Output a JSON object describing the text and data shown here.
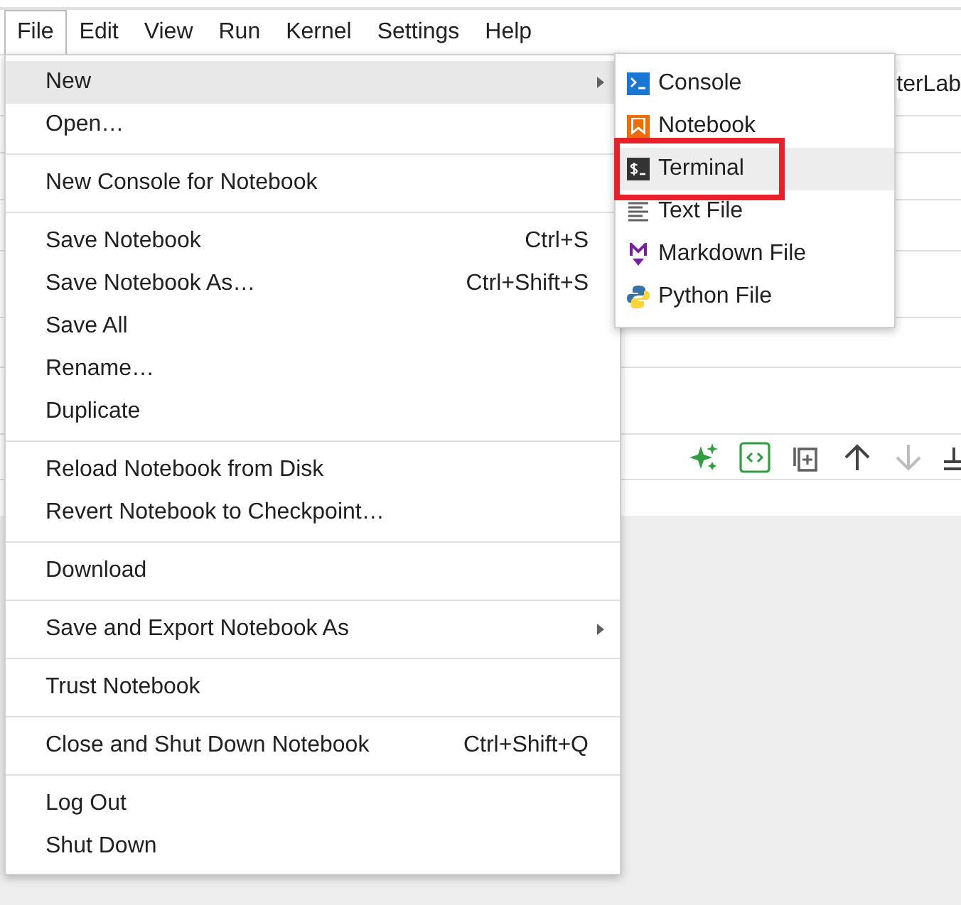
{
  "menubar": [
    {
      "label": "File",
      "selected": true
    },
    {
      "label": "Edit",
      "selected": false
    },
    {
      "label": "View",
      "selected": false
    },
    {
      "label": "Run",
      "selected": false
    },
    {
      "label": "Kernel",
      "selected": false
    },
    {
      "label": "Settings",
      "selected": false
    },
    {
      "label": "Help",
      "selected": false
    }
  ],
  "background_tab": {
    "title": "terLab"
  },
  "file_menu": [
    {
      "kind": "item",
      "label": "New",
      "submenu": true,
      "highlighted": true
    },
    {
      "kind": "item",
      "label": "Open…",
      "highlighted": false
    },
    {
      "kind": "separator"
    },
    {
      "kind": "item",
      "label": "New Console for Notebook",
      "highlighted": false
    },
    {
      "kind": "separator"
    },
    {
      "kind": "item",
      "label": "Save Notebook",
      "shortcut": "Ctrl+S",
      "highlighted": false
    },
    {
      "kind": "item",
      "label": "Save Notebook As…",
      "shortcut": "Ctrl+Shift+S",
      "highlighted": false
    },
    {
      "kind": "item",
      "label": "Save All",
      "highlighted": false
    },
    {
      "kind": "item",
      "label": "Rename…",
      "highlighted": false
    },
    {
      "kind": "item",
      "label": "Duplicate",
      "highlighted": false
    },
    {
      "kind": "separator"
    },
    {
      "kind": "item",
      "label": "Reload Notebook from Disk",
      "highlighted": false
    },
    {
      "kind": "item",
      "label": "Revert Notebook to Checkpoint…",
      "highlighted": false
    },
    {
      "kind": "separator"
    },
    {
      "kind": "item",
      "label": "Download",
      "highlighted": false
    },
    {
      "kind": "separator"
    },
    {
      "kind": "item",
      "label": "Save and Export Notebook As",
      "submenu": true,
      "highlighted": false
    },
    {
      "kind": "separator"
    },
    {
      "kind": "item",
      "label": "Trust Notebook",
      "highlighted": false
    },
    {
      "kind": "separator"
    },
    {
      "kind": "item",
      "label": "Close and Shut Down Notebook",
      "shortcut": "Ctrl+Shift+Q",
      "highlighted": false
    },
    {
      "kind": "separator"
    },
    {
      "kind": "item",
      "label": "Log Out",
      "highlighted": false
    },
    {
      "kind": "item",
      "label": "Shut Down",
      "highlighted": false
    }
  ],
  "new_submenu": [
    {
      "kind": "console",
      "label": "Console",
      "highlighted": false,
      "marked": false
    },
    {
      "kind": "notebook",
      "label": "Notebook",
      "highlighted": false,
      "marked": false
    },
    {
      "kind": "terminal",
      "label": "Terminal",
      "highlighted": true,
      "marked": true
    },
    {
      "kind": "text",
      "label": "Text File",
      "highlighted": false,
      "marked": false
    },
    {
      "kind": "markdown",
      "label": "Markdown File",
      "highlighted": false,
      "marked": false
    },
    {
      "kind": "python",
      "label": "Python File",
      "highlighted": false,
      "marked": false
    }
  ]
}
